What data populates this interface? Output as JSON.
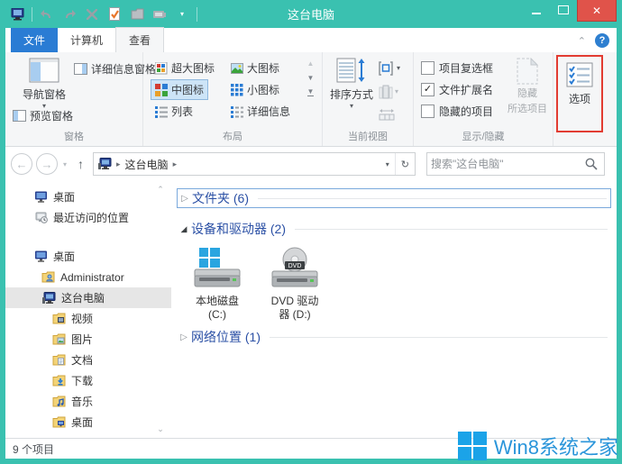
{
  "colors": {
    "accent_teal": "#3ac1b0",
    "close_red": "#e0534a",
    "file_tab_blue": "#2a7cd4",
    "group_header_blue": "#2b50a5",
    "selected_item_blue": "#cde4f7",
    "highlight_red_box": "#e23c32",
    "watermark_blue": "#2a95da"
  },
  "titlebar": {
    "title": "这台电脑"
  },
  "tabs": {
    "file": "文件",
    "computer": "计算机",
    "view": "查看"
  },
  "ribbon": {
    "panes": {
      "group_label": "窗格",
      "nav_pane": "导航窗格",
      "details_pane": "详细信息窗格",
      "preview_pane": "预览窗格"
    },
    "layout": {
      "group_label": "布局",
      "items": [
        {
          "label": "超大图标",
          "selected": false
        },
        {
          "label": "大图标",
          "selected": false
        },
        {
          "label": "中图标",
          "selected": true
        },
        {
          "label": "小图标",
          "selected": false
        },
        {
          "label": "列表",
          "selected": false
        },
        {
          "label": "详细信息",
          "selected": false
        }
      ]
    },
    "current_view": {
      "group_label": "当前视图",
      "sort_by": "排序方式"
    },
    "show_hide": {
      "group_label": "显示/隐藏",
      "checkboxes": [
        {
          "label": "项目复选框",
          "checked": false
        },
        {
          "label": "文件扩展名",
          "checked": true
        },
        {
          "label": "隐藏的项目",
          "checked": false
        }
      ],
      "hide_selected_line1": "隐藏",
      "hide_selected_line2": "所选项目"
    },
    "options": {
      "label": "选项",
      "highlighted": true
    }
  },
  "address_bar": {
    "breadcrumb_root": "这台电脑",
    "search_placeholder": "搜索\"这台电脑\""
  },
  "sidebar": {
    "favorites": [
      {
        "label": "桌面"
      },
      {
        "label": "最近访问的位置"
      }
    ],
    "tree": [
      {
        "label": "桌面",
        "selected": false
      },
      {
        "label": "Administrator",
        "selected": false
      },
      {
        "label": "这台电脑",
        "selected": true
      },
      {
        "label": "视频",
        "selected": false
      },
      {
        "label": "图片",
        "selected": false
      },
      {
        "label": "文档",
        "selected": false
      },
      {
        "label": "下载",
        "selected": false
      },
      {
        "label": "音乐",
        "selected": false
      },
      {
        "label": "桌面",
        "selected": false
      }
    ]
  },
  "content": {
    "groups": [
      {
        "header": "文件夹 (6)",
        "state": "collapsed",
        "focused": true
      },
      {
        "header": "设备和驱动器 (2)",
        "state": "expanded",
        "focused": false
      },
      {
        "header": "网络位置 (1)",
        "state": "collapsed",
        "focused": false
      }
    ],
    "drives": [
      {
        "line1": "本地磁盘",
        "line2": "(C:)"
      },
      {
        "line1": "DVD 驱动",
        "line2": "器 (D:)"
      }
    ],
    "dvd_disc_label": "DVD"
  },
  "status_bar": {
    "text": "9 个项目"
  },
  "watermark": {
    "text": "Win8系统之家"
  },
  "icons": [
    "pc-icon",
    "undo-icon",
    "redo-icon",
    "delete-icon",
    "properties-icon",
    "new-folder-icon",
    "slideshow-icon",
    "dropdown-icon",
    "minimize-icon",
    "maximize-icon",
    "close-icon",
    "collapse-ribbon-icon",
    "help-icon",
    "nav-pane-icon",
    "details-pane-icon",
    "preview-pane-icon",
    "extra-large-icons-icon",
    "large-icons-icon",
    "medium-icons-icon",
    "small-icons-icon",
    "list-icon",
    "details-view-icon",
    "sort-by-icon",
    "group-by-icon",
    "add-columns-icon",
    "size-columns-icon",
    "hide-selected-icon",
    "options-icon",
    "back-icon",
    "forward-icon",
    "up-icon",
    "refresh-icon",
    "search-icon",
    "desktop-icon",
    "recent-places-icon",
    "user-folder-icon",
    "this-pc-icon",
    "folder-icon",
    "hard-drive-icon",
    "dvd-drive-icon",
    "windows-logo-icon",
    "scroll-up-icon",
    "scroll-down-icon"
  ]
}
